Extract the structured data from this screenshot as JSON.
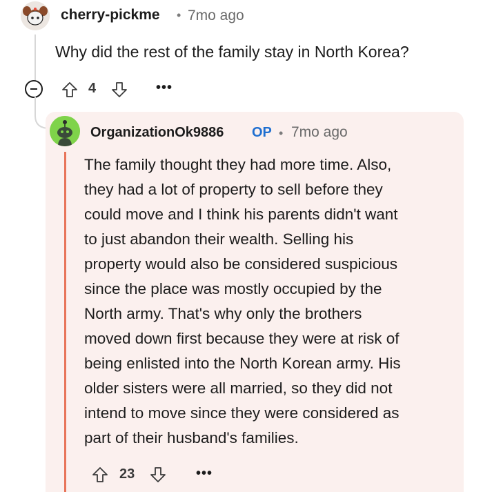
{
  "top_comment": {
    "author": "cherry-pickme",
    "separator": "•",
    "time": "7mo ago",
    "body": "Why did the rest of the family stay in North Korea?",
    "score": "4",
    "more": "•••",
    "avatar_icon": "snoo-avatar-pigtails-icon"
  },
  "reply": {
    "author": "OrganizationOk9886",
    "badge": "OP",
    "separator": "•",
    "time": "7mo ago",
    "avatar_icon": "snoo-avatar-green-icon",
    "body_lines": [
      "The family thought they had more time. Also,",
      "they had a lot of property to sell before they",
      "could move and I think his parents didn't want",
      "to just abandon their wealth. Selling his",
      "property would also be considered suspicious",
      "since the place was mostly occupied by the",
      "North army. That's why only the brothers",
      "moved down first because they were at risk of",
      "being enlisted into the North Korean army. His",
      "older sisters were all married, so they did not",
      "intend to move since they were considered as",
      "part of their husband's families."
    ],
    "score": "23",
    "more": "•••"
  },
  "colors": {
    "op_badge": "#1f6fd0",
    "op_thread_line": "#e8745a",
    "reply_highlight": "#fbf0ee"
  }
}
